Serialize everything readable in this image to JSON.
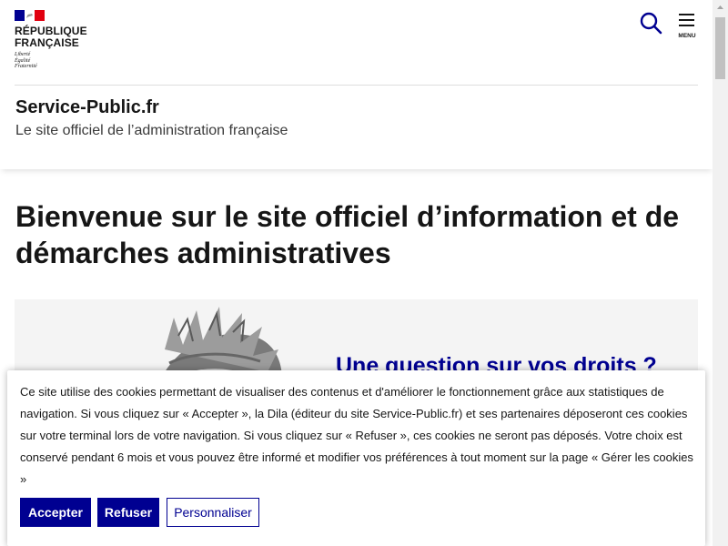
{
  "header": {
    "brand": {
      "republique": "RÉPUBLIQUE",
      "francaise": "FRANÇAISE",
      "devise": [
        "Liberté",
        "Égalité",
        "Fraternité"
      ],
      "flag_colors": [
        "#000091",
        "#ffffff",
        "#e1000f"
      ]
    },
    "menu_label": "MENU",
    "site_name": "Service-Public.fr",
    "tagline": "Le site officiel de l’administration française"
  },
  "main": {
    "title": "Bienvenue sur le site officiel d’information et de démarches administratives",
    "hero_heading": "Une question sur vos droits ?"
  },
  "cookie_banner": {
    "text": "Ce site utilise des cookies permettant de visualiser des contenus et d'améliorer le fonctionnement grâce aux statistiques de navigation. Si vous cliquez sur « Accepter », la Dila (éditeur du site Service-Public.fr) et ses partenaires déposeront ces cookies sur votre terminal lors de votre navigation. Si vous cliquez sur « Refuser », ces cookies ne seront pas déposés. Votre choix est conservé pendant 6 mois et vous pouvez être informé et modifier vos préférences à tout moment sur la page « Gérer les cookies »",
    "accept_label": "Accepter",
    "refuse_label": "Refuser",
    "customize_label": "Personnaliser"
  },
  "colors": {
    "primary": "#000091",
    "text": "#161616",
    "hero_bg": "#f4f4f4"
  }
}
